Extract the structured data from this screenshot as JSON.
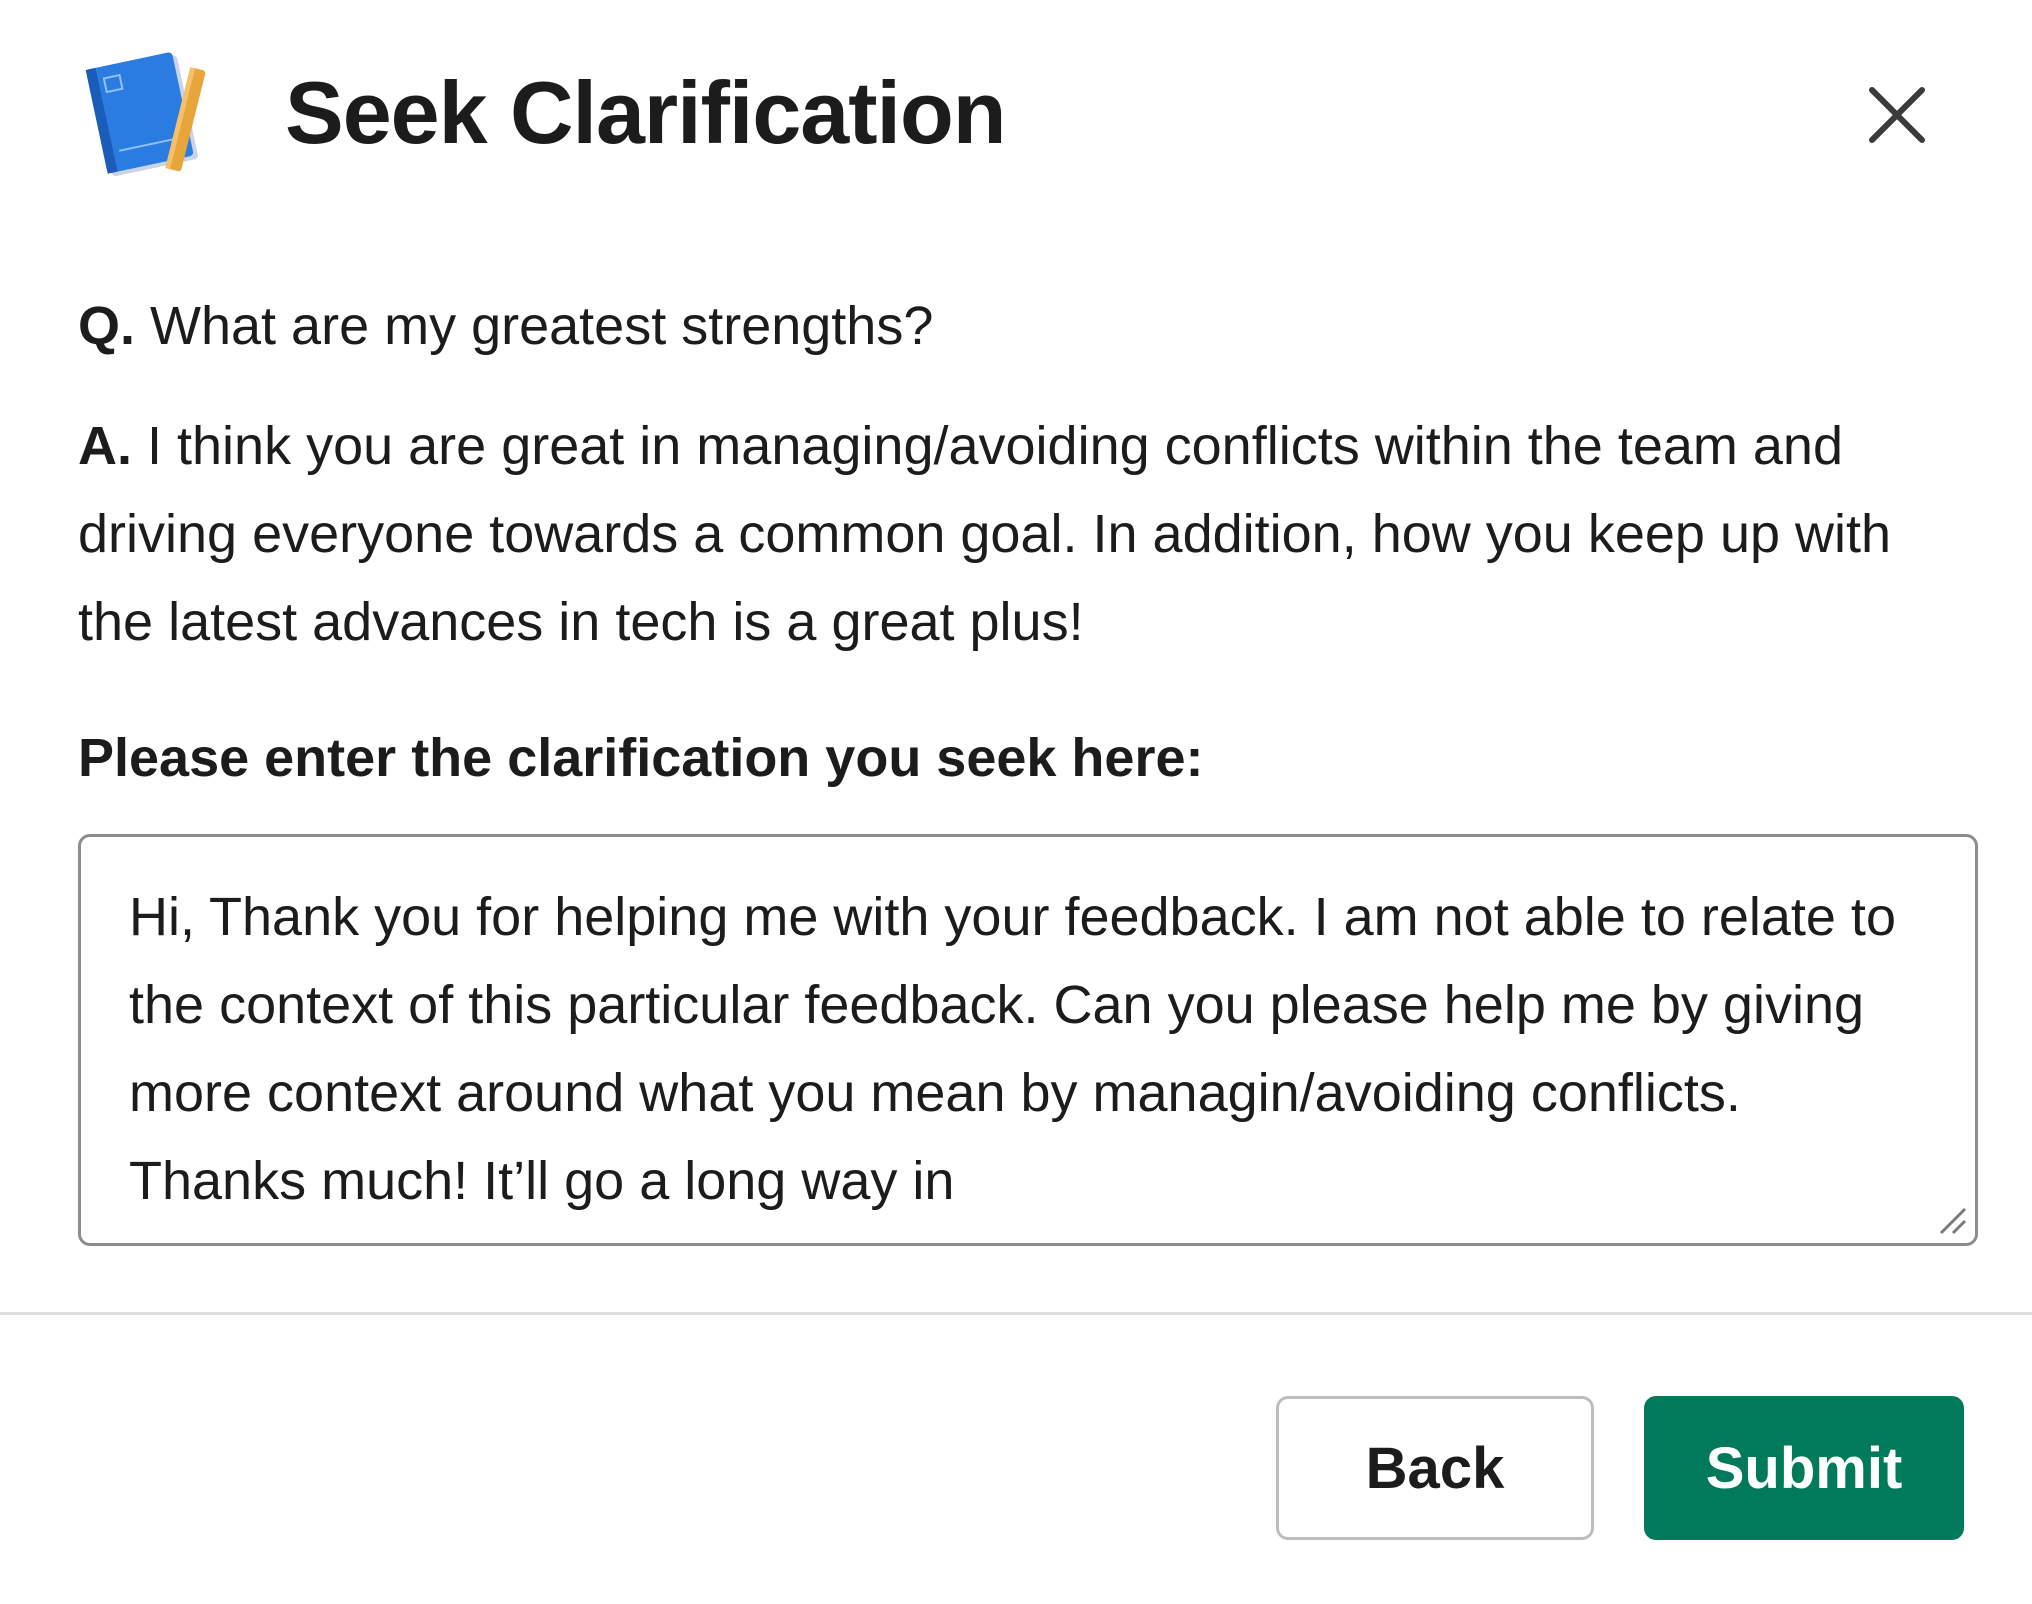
{
  "modal": {
    "title": "Seek Clarification",
    "close_icon": "close-icon",
    "app_icon": "notebook-icon"
  },
  "qa": {
    "question_prefix": "Q.",
    "question_text": " What are my greatest strengths?",
    "answer_prefix": "A.",
    "answer_text": " I think you are great in managing/avoiding conflicts within the team and driving everyone towards a common goal. In addition, how you keep up with the latest advances in tech is a great plus!"
  },
  "clarification": {
    "label": "Please enter the clarification you seek here:",
    "value": "Hi, Thank you for helping me with your feedback. I am not able to relate to the context of this particular feedback. Can you please help me by giving more context around what you mean by managin/avoiding conflicts. Thanks much! It’ll go a long way in"
  },
  "footer": {
    "back_label": "Back",
    "submit_label": "Submit"
  },
  "colors": {
    "submit_bg": "#007a5a",
    "text": "#1d1c1d",
    "border": "#8d8d8d"
  }
}
